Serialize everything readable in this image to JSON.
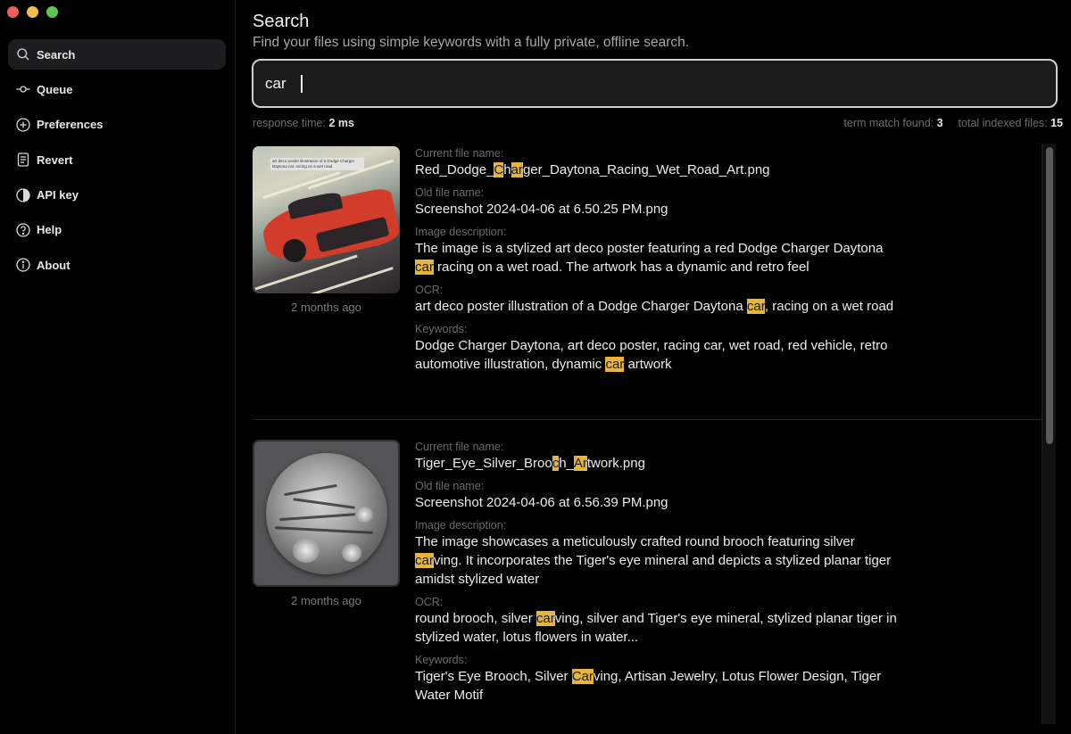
{
  "window": {
    "traffic_lights": [
      "close",
      "minimize",
      "maximize"
    ]
  },
  "sidebar": {
    "items": [
      {
        "label": "Search",
        "icon": "search-icon",
        "active": true
      },
      {
        "label": "Queue",
        "icon": "commit-icon",
        "active": false
      },
      {
        "label": "Preferences",
        "icon": "plus-circle-icon",
        "active": false
      },
      {
        "label": "Revert",
        "icon": "document-icon",
        "active": false
      },
      {
        "label": "API key",
        "icon": "half-circle-icon",
        "active": false
      },
      {
        "label": "Help",
        "icon": "question-circle-icon",
        "active": false
      },
      {
        "label": "About",
        "icon": "info-circle-icon",
        "active": false
      }
    ]
  },
  "header": {
    "title": "Search",
    "subtitle": "Find your files using simple keywords with a fully private, offline search."
  },
  "search": {
    "value": "car",
    "placeholder": ""
  },
  "stats": {
    "response_time_label": "response time:",
    "response_time_value": "2 ms",
    "term_match_label": "term match found:",
    "term_match_value": "3",
    "total_indexed_label": "total indexed files:",
    "total_indexed_value": "15"
  },
  "labels": {
    "current_file_name": "Current file name:",
    "old_file_name": "Old file name:",
    "image_description": "Image description:",
    "ocr": "OCR:",
    "keywords": "Keywords:"
  },
  "accent_colors": {
    "highlight": "#e7b53c",
    "active_nav_bg": "#1d1d1f"
  },
  "results": [
    {
      "date": "2 months ago",
      "thumbnail_ocr_overlay": "art deco poster illustration of a Dodge Charger Daytona car, racing on a wet road",
      "current_file_name": [
        {
          "t": "Red_Dodge_"
        },
        {
          "t": "C",
          "h": true
        },
        {
          "t": "h"
        },
        {
          "t": "ar",
          "h": true
        },
        {
          "t": "ger_Daytona_Racing_Wet_Road_Art.png"
        }
      ],
      "old_file_name": "Screenshot 2024-04-06 at 6.50.25 PM.png",
      "image_description": [
        {
          "t": "The image is a stylized art deco poster featuring a red Dodge Charger Daytona "
        },
        {
          "t": "car",
          "h": true
        },
        {
          "t": " racing on a wet road. The artwork has a dynamic and retro feel"
        }
      ],
      "ocr": [
        {
          "t": "art deco poster illustration of a Dodge Charger Daytona "
        },
        {
          "t": "car",
          "h": true
        },
        {
          "t": ", racing on a wet road"
        }
      ],
      "keywords": [
        {
          "t": "Dodge Charger Daytona, art deco poster, racing car, wet road, red vehicle, retro automotive illustration, dynamic "
        },
        {
          "t": "car",
          "h": true
        },
        {
          "t": " artwork"
        }
      ]
    },
    {
      "date": "2 months ago",
      "current_file_name": [
        {
          "t": "Tiger_Eye_Silver_Broo"
        },
        {
          "t": "c",
          "h": true
        },
        {
          "t": "h_"
        },
        {
          "t": "Ar",
          "h": true
        },
        {
          "t": "twork.png"
        }
      ],
      "old_file_name": "Screenshot 2024-04-06 at 6.56.39 PM.png",
      "image_description": [
        {
          "t": "The image showcases a meticulously crafted round brooch featuring silver "
        },
        {
          "t": "car",
          "h": true
        },
        {
          "t": "ving. It incorporates the Tiger's eye mineral and depicts a stylized planar tiger amidst stylized water"
        }
      ],
      "ocr": [
        {
          "t": "round brooch, silver "
        },
        {
          "t": "car",
          "h": true
        },
        {
          "t": "ving, silver and Tiger's eye mineral, stylized planar tiger in stylized water, lotus flowers in water..."
        }
      ],
      "keywords": [
        {
          "t": "Tiger's Eye Brooch, Silver "
        },
        {
          "t": "Car",
          "h": true
        },
        {
          "t": "ving, Artisan Jewelry, Lotus Flower Design, Tiger Water Motif"
        }
      ]
    }
  ]
}
